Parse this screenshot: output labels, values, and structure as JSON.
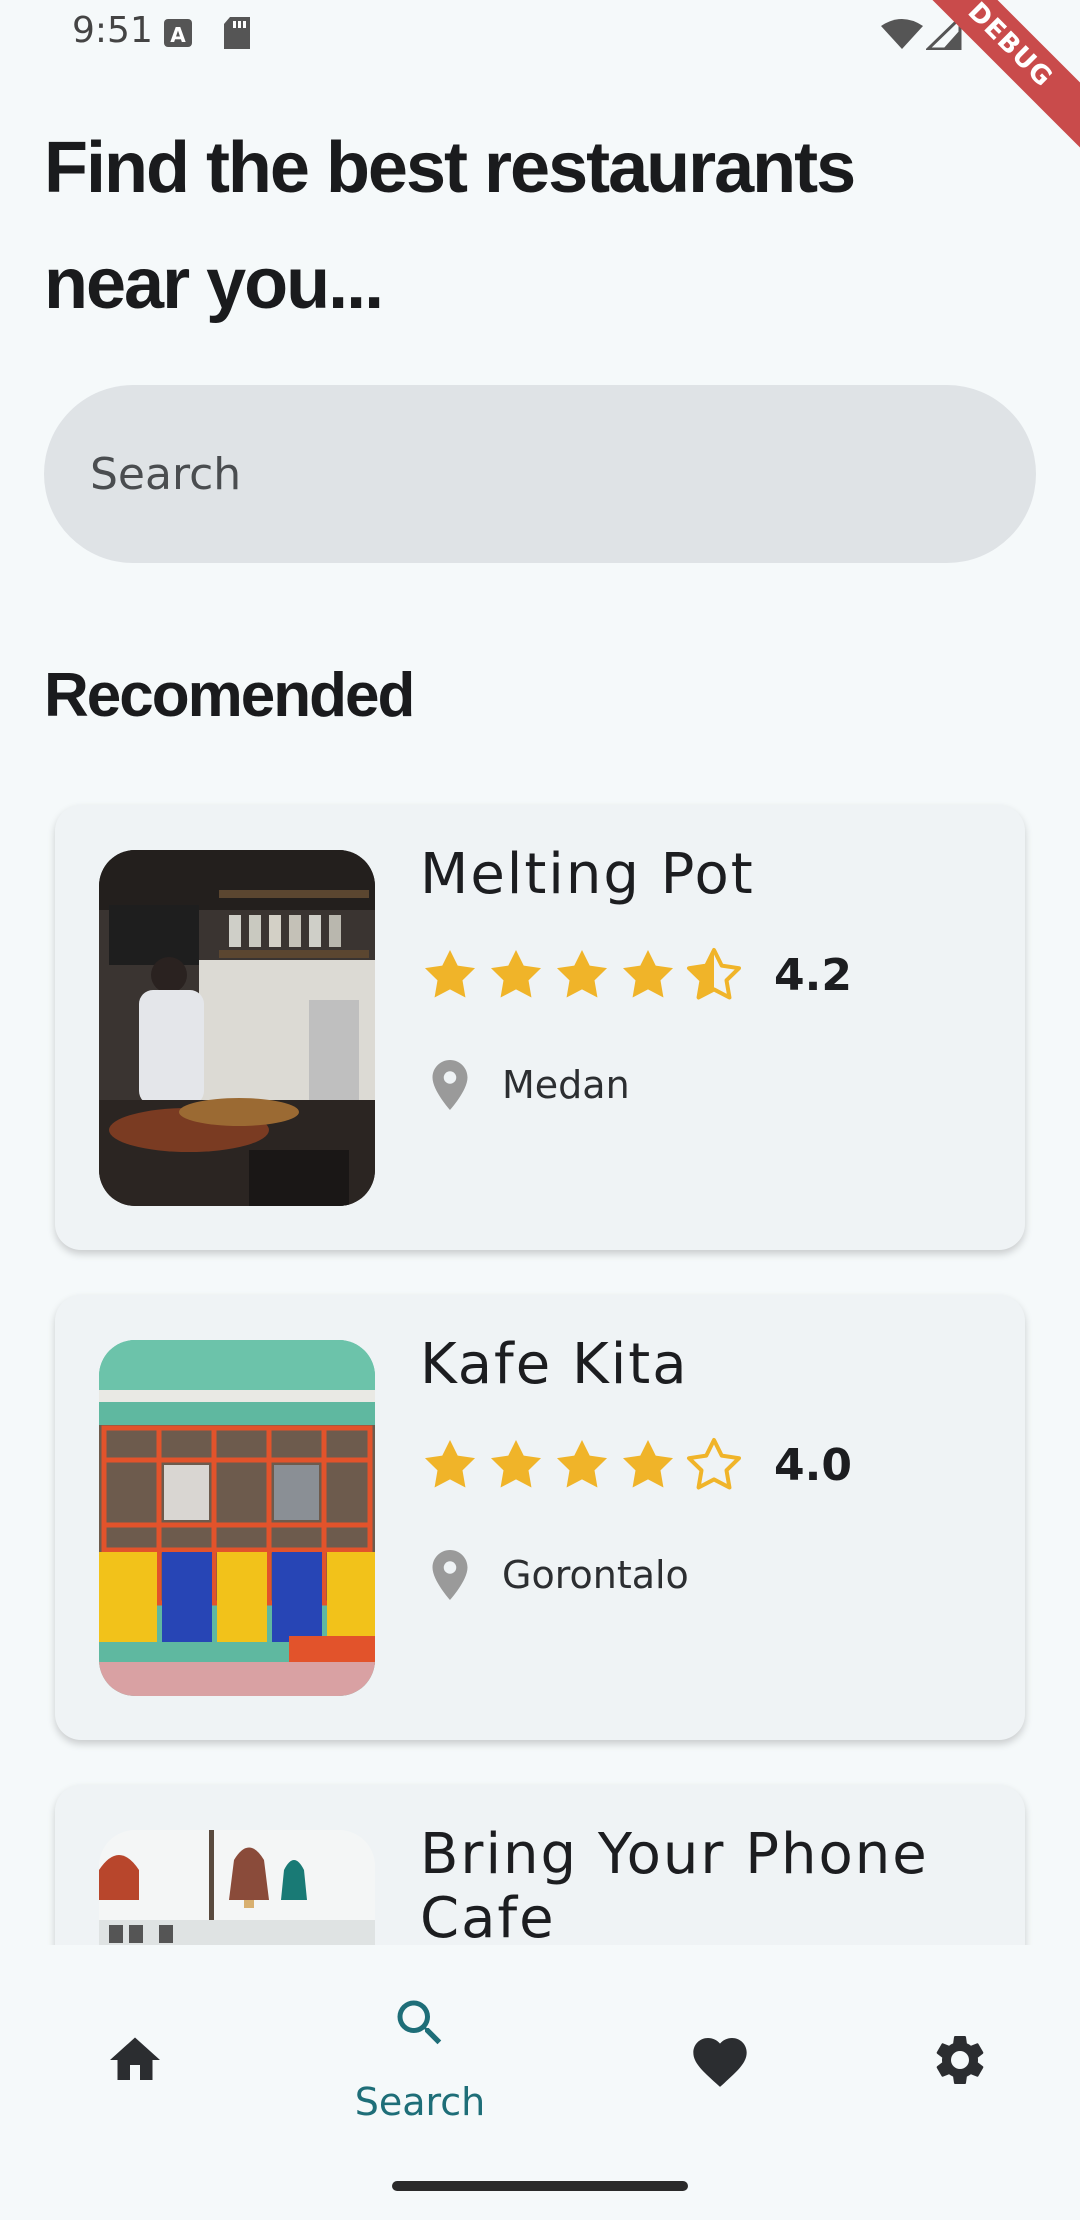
{
  "status_bar": {
    "time": "9:51",
    "debug_label": "DEBUG"
  },
  "headline": "Find the best restaurants near you...",
  "search": {
    "placeholder": "Search"
  },
  "section_title": "Recomended",
  "restaurants": [
    {
      "name": "Melting Pot",
      "rating": 4.2,
      "rating_label": "4.2",
      "city": "Medan"
    },
    {
      "name": "Kafe Kita",
      "rating": 4.0,
      "rating_label": "4.0",
      "city": "Gorontalo"
    },
    {
      "name": "Bring Your Phone Cafe",
      "rating": null,
      "rating_label": "",
      "city": ""
    }
  ],
  "bottom_nav": {
    "items": [
      {
        "id": "home",
        "icon": "home-icon",
        "label": ""
      },
      {
        "id": "search",
        "icon": "search-icon",
        "label": "Search",
        "active": true
      },
      {
        "id": "favorites",
        "icon": "heart-icon",
        "label": ""
      },
      {
        "id": "settings",
        "icon": "gear-icon",
        "label": ""
      }
    ]
  },
  "colors": {
    "accent": "#1e6e78",
    "star": "#f0b429",
    "icon_dark": "#2b2d30",
    "pin": "#9a9a9a"
  }
}
